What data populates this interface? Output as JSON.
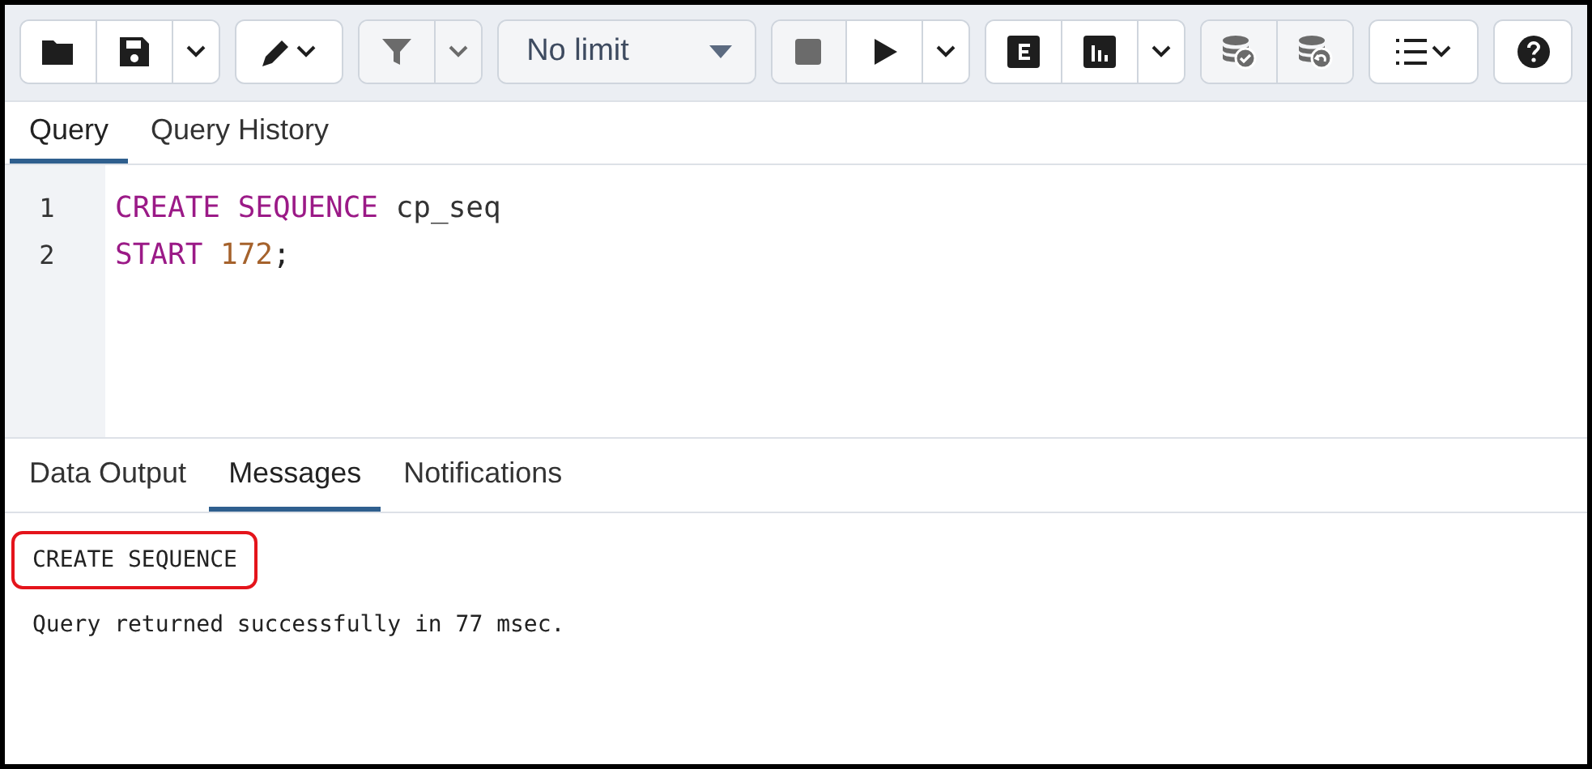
{
  "toolbar": {
    "groups": [
      [
        {
          "kind": "open",
          "disabled": false
        },
        {
          "kind": "save",
          "disabled": false
        },
        {
          "kind": "caret",
          "disabled": false
        }
      ],
      [
        {
          "kind": "edit",
          "disabled": false
        }
      ],
      [
        {
          "kind": "filter",
          "disabled": true
        },
        {
          "kind": "caret",
          "disabled": true
        }
      ],
      [
        {
          "kind": "limit",
          "label": "No limit"
        }
      ],
      [
        {
          "kind": "stop",
          "disabled": true
        },
        {
          "kind": "run",
          "disabled": false
        },
        {
          "kind": "caret",
          "disabled": false
        }
      ],
      [
        {
          "kind": "explain",
          "disabled": false
        },
        {
          "kind": "analyze",
          "disabled": false
        },
        {
          "kind": "caret",
          "disabled": false
        }
      ],
      [
        {
          "kind": "commit",
          "disabled": true
        },
        {
          "kind": "rollback",
          "disabled": true
        }
      ],
      [
        {
          "kind": "macros",
          "disabled": false
        }
      ],
      [
        {
          "kind": "help",
          "disabled": false
        }
      ]
    ]
  },
  "editor_tabs": [
    {
      "label": "Query",
      "selected": true
    },
    {
      "label": "Query History",
      "selected": false
    }
  ],
  "editor": {
    "lines": [
      {
        "number": "1",
        "tokens": [
          {
            "text": "CREATE",
            "kind": "keyword"
          },
          {
            "text": "SEQUENCE",
            "kind": "keyword"
          },
          {
            "text": "cp_seq",
            "kind": "ident"
          }
        ]
      },
      {
        "number": "2",
        "tokens": [
          {
            "text": "START",
            "kind": "keyword"
          },
          {
            "text": "172",
            "kind": "number"
          },
          {
            "text": ";",
            "kind": "punct",
            "attached": true
          }
        ]
      }
    ]
  },
  "output_tabs": [
    {
      "label": "Data Output",
      "selected": false
    },
    {
      "label": "Messages",
      "selected": true
    },
    {
      "label": "Notifications",
      "selected": false
    }
  ],
  "messages": [
    {
      "text": "CREATE SEQUENCE",
      "highlighted": true
    },
    {
      "text": "Query returned successfully in 77 msec.",
      "highlighted": false
    }
  ]
}
